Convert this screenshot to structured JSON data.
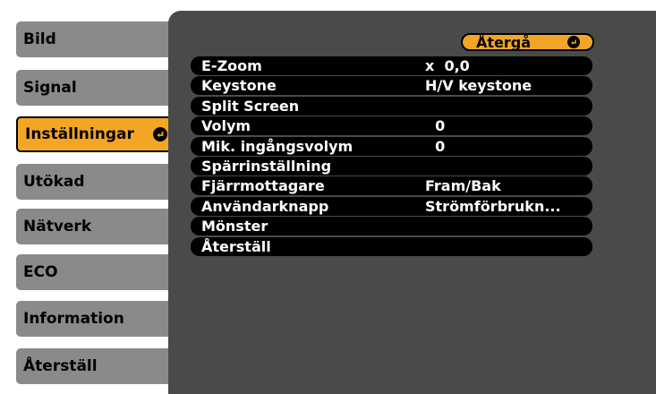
{
  "sidebar": {
    "items": [
      {
        "label": "Bild",
        "active": false
      },
      {
        "label": "Signal",
        "active": false
      },
      {
        "label": "Inställningar",
        "active": true
      },
      {
        "label": "Utökad",
        "active": false
      },
      {
        "label": "Nätverk",
        "active": false
      },
      {
        "label": "ECO",
        "active": false
      },
      {
        "label": "Information",
        "active": false
      },
      {
        "label": "Återställ",
        "active": false
      }
    ]
  },
  "panel": {
    "return_label": "Återgå",
    "rows": [
      {
        "label": "E-Zoom",
        "value": "x  0,0"
      },
      {
        "label": "Keystone",
        "value": "H/V keystone"
      },
      {
        "label": "Split Screen",
        "value": ""
      },
      {
        "label": "Volym",
        "value": "  0"
      },
      {
        "label": "Mik. ingångsvolym",
        "value": "  0"
      },
      {
        "label": "Spärrinställning",
        "value": ""
      },
      {
        "label": "Fjärrmottagare",
        "value": "Fram/Bak"
      },
      {
        "label": "Användarknapp",
        "value": "Strömförbrukn..."
      },
      {
        "label": "Mönster",
        "value": ""
      },
      {
        "label": "Återställ",
        "value": ""
      }
    ]
  },
  "colors": {
    "accent": "#f3a526",
    "sidebar_item": "#8a8a8a",
    "panel_bg": "#4a4a4a",
    "row_bg": "#000000"
  },
  "icons": {
    "enter": "enter-icon"
  }
}
